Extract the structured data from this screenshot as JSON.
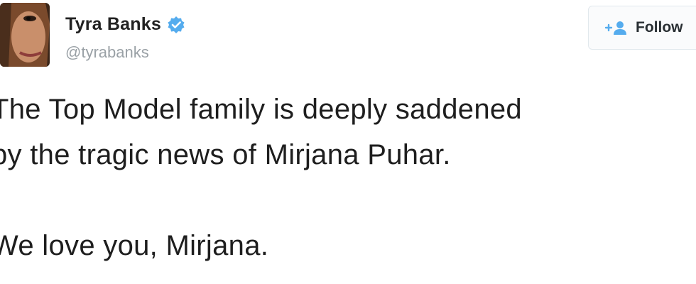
{
  "user": {
    "display_name": "Tyra Banks",
    "handle": "@tyrabanks",
    "verified": true,
    "avatar_icon": "profile-photo"
  },
  "follow_button": {
    "label": "Follow",
    "icon": "follow-person-icon",
    "accent": "#55acee"
  },
  "tweet": {
    "line1": "The Top Model family is deeply saddened",
    "line2": "by the tragic news of Mirjana Puhar.",
    "line3": "We love you, Mirjana."
  },
  "colors": {
    "verified_badge": "#55acee",
    "handle_gray": "#9aa1a6"
  }
}
